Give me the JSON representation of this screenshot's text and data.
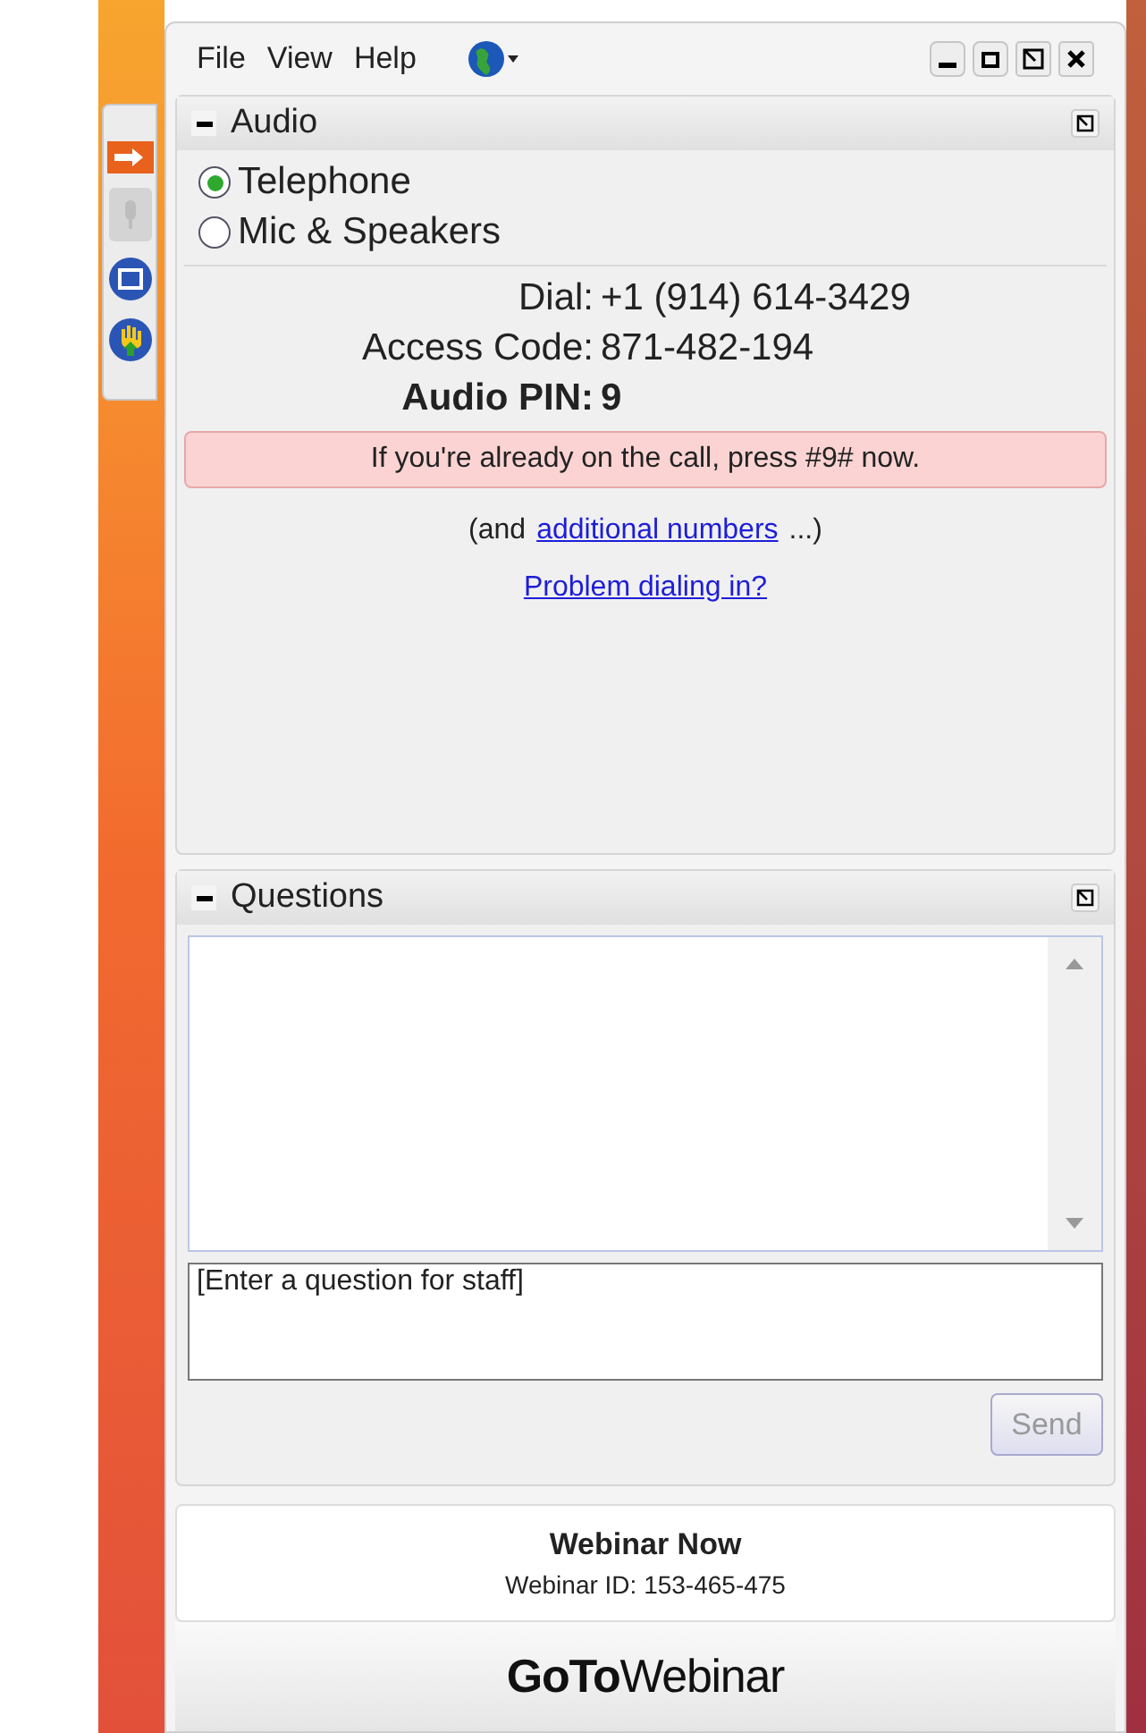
{
  "menu": [
    "File",
    "View",
    "Help"
  ],
  "audio": {
    "title": "Audio",
    "options": [
      {
        "label": "Telephone",
        "selected": true
      },
      {
        "label": "Mic & Speakers",
        "selected": false
      }
    ],
    "details": [
      {
        "label": "Dial:",
        "value": "+1 (914) 614-3429",
        "bold": false
      },
      {
        "label": "Access Code:",
        "value": "871-482-194",
        "bold": false
      },
      {
        "label": "Audio PIN:",
        "value": "9",
        "bold": true
      }
    ],
    "notice": "If you're already on the call, press #9# now.",
    "more_before": "(and",
    "more_link": "additional numbers",
    "more_after": "...)",
    "problem_link": "Problem dialing in?"
  },
  "questions": {
    "title": "Questions",
    "input_placeholder": "[Enter a question for staff]",
    "send": "Send"
  },
  "webinar": {
    "title": "Webinar Now",
    "id": "Webinar ID: 153-465-475"
  },
  "logo": "**GoTo**Webinar"
}
